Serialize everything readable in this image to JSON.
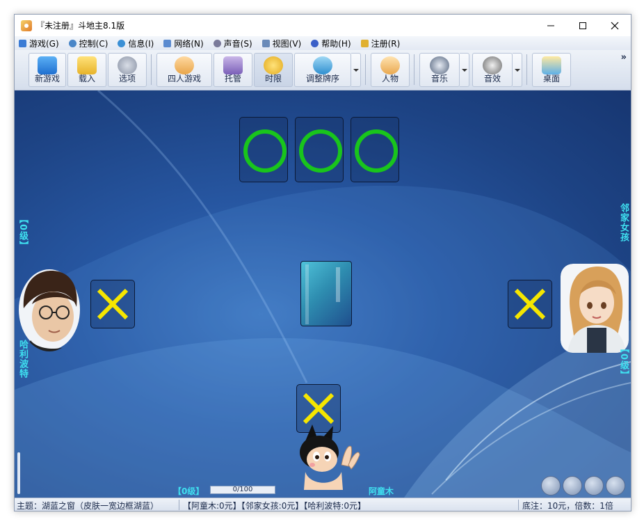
{
  "window": {
    "title": "『未注册』斗地主8.1版",
    "controls": {
      "minimize": "–",
      "maximize": "□",
      "close": "✕"
    }
  },
  "menu": [
    {
      "label": "游戏(G)",
      "icon": "game-icon",
      "color": "#3a7bd5"
    },
    {
      "label": "控制(C)",
      "icon": "gear-icon",
      "color": "#4a86c8"
    },
    {
      "label": "信息(I)",
      "icon": "info-icon",
      "color": "#3a8fd5"
    },
    {
      "label": "网络(N)",
      "icon": "network-icon",
      "color": "#5b8bd0"
    },
    {
      "label": "声音(S)",
      "icon": "sound-icon",
      "color": "#7a7a9a"
    },
    {
      "label": "视图(V)",
      "icon": "view-icon",
      "color": "#6a8ab8"
    },
    {
      "label": "帮助(H)",
      "icon": "help-icon",
      "color": "#3a5fc8"
    },
    {
      "label": "注册(R)",
      "icon": "register-icon",
      "color": "#e0b030"
    }
  ],
  "toolbar": {
    "new_game": "新游戏",
    "load": "载入",
    "options": "选项",
    "four_player": "四人游戏",
    "auto_play": "托管",
    "time_limit": "时限",
    "sort_cards": "调整牌序",
    "character": "人物",
    "music": "音乐",
    "sound_fx": "音效",
    "desktop": "桌面",
    "more": "»"
  },
  "game": {
    "left_player": {
      "name": "哈利波特",
      "level": "【0级】"
    },
    "right_player": {
      "name": "邻家女孩",
      "level": "【0级】"
    },
    "me": {
      "name": "阿童木",
      "level": "【0级】"
    },
    "progress": {
      "value": 0,
      "max": 100,
      "text": "0/100"
    },
    "bottom_cards": [
      "O",
      "O",
      "O"
    ]
  },
  "status": {
    "theme": "主题：湖蓝之窗（皮肤一宽边框湖蓝）",
    "money": "【阿童木:0元】【邻家女孩:0元】【哈利波特:0元】",
    "stakes": "底注：10元，倍数：1倍"
  },
  "colors": {
    "accent_green": "#19c51c",
    "accent_yellow": "#f5e600",
    "label_cyan": "#3fe0f0"
  }
}
